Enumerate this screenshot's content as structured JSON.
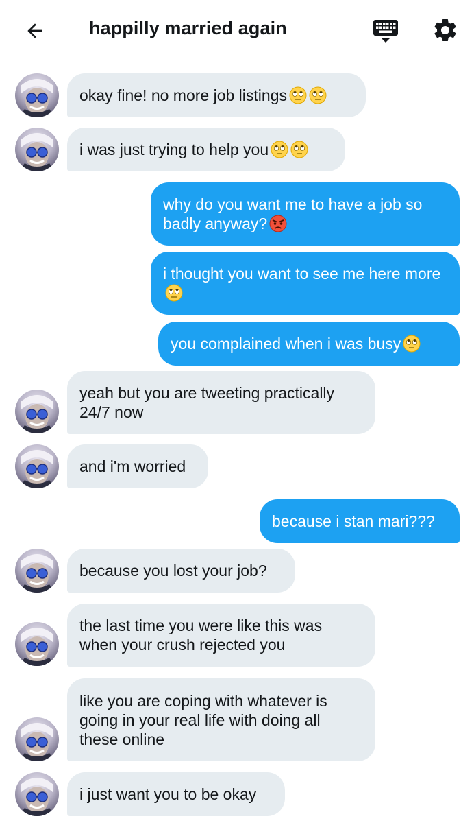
{
  "header": {
    "title": "happilly married again",
    "back_icon": "arrow-left-icon",
    "keyboard_icon": "keyboard-icon",
    "settings_icon": "gear-icon"
  },
  "colors": {
    "sent_bubble": "#1da1f2",
    "received_bubble": "#e6ecf0",
    "text": "#14171a"
  },
  "messages": [
    {
      "side": "in",
      "text": "okay fine! no more job listings",
      "emoji": [
        "face-with-rolling-eyes",
        "face-with-rolling-eyes"
      ]
    },
    {
      "side": "in",
      "text": "i was just trying to help you",
      "emoji": [
        "face-with-rolling-eyes",
        "face-with-rolling-eyes"
      ]
    },
    {
      "side": "out",
      "text": "why do you want me to have a job so badly anyway?",
      "emoji": [
        "pouting-face"
      ]
    },
    {
      "side": "out",
      "text": "i thought you want to see me here more",
      "emoji": [
        "face-with-rolling-eyes"
      ]
    },
    {
      "side": "out",
      "text": "you complained when i was busy",
      "emoji": [
        "face-with-rolling-eyes"
      ]
    },
    {
      "side": "in",
      "text": "yeah but you are tweeting practically 24/7 now",
      "emoji": []
    },
    {
      "side": "in",
      "text": "and i'm worried",
      "emoji": []
    },
    {
      "side": "out",
      "text": "because i stan mari???",
      "emoji": []
    },
    {
      "side": "in",
      "text": "because you lost your job?",
      "emoji": []
    },
    {
      "side": "in",
      "text": "the last time you were like this was when your crush rejected you",
      "emoji": []
    },
    {
      "side": "in",
      "text": "like you are coping with whatever is going in your real life with doing all these online",
      "emoji": []
    },
    {
      "side": "in",
      "text": "i just want you to be okay",
      "emoji": []
    }
  ]
}
